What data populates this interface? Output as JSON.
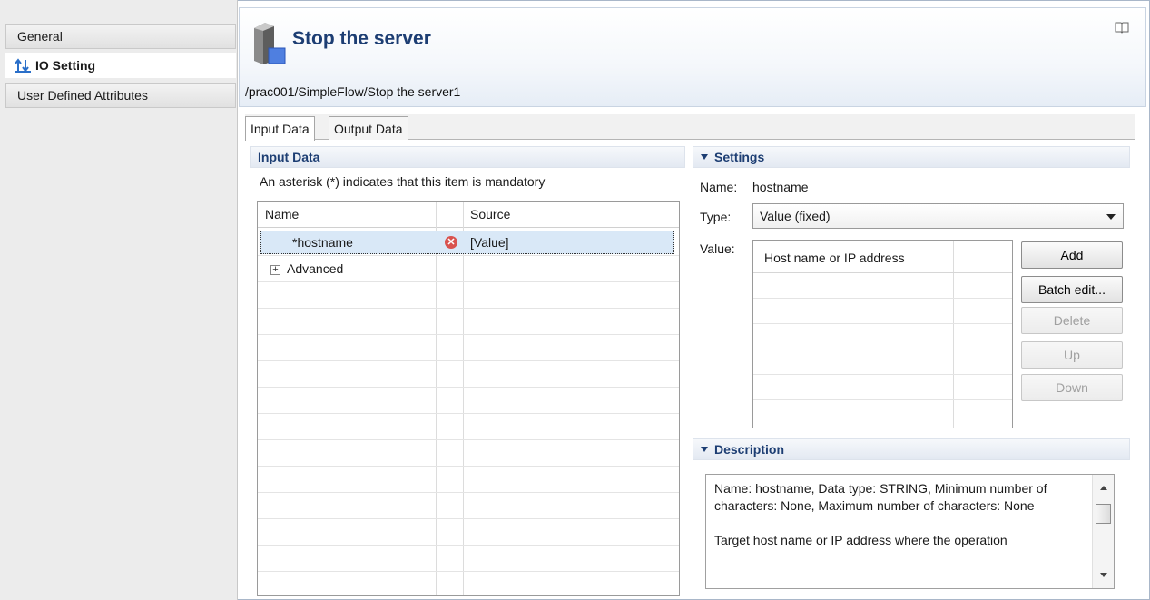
{
  "sidebar": {
    "items": [
      {
        "label": "General"
      },
      {
        "label": "IO Setting"
      },
      {
        "label": "User Defined Attributes"
      }
    ]
  },
  "header": {
    "title": "Stop the server",
    "path": "/prac001/SimpleFlow/Stop the server1"
  },
  "tabs": [
    {
      "label": "Input Data"
    },
    {
      "label": "Output Data"
    }
  ],
  "input_data": {
    "section_title": "Input Data",
    "hint": "An asterisk (*) indicates that this item is mandatory",
    "columns": [
      "Name",
      "Source"
    ],
    "rows": [
      {
        "name": "*hostname",
        "source": "[Value]"
      },
      {
        "name": "Advanced",
        "source": ""
      }
    ]
  },
  "settings": {
    "section_title": "Settings",
    "name_label": "Name:",
    "name_value": "hostname",
    "type_label": "Type:",
    "type_value": "Value (fixed)",
    "value_label": "Value:",
    "value_column": "Host name or IP address",
    "buttons": {
      "add": "Add",
      "batch_edit": "Batch edit...",
      "delete": "Delete",
      "up": "Up",
      "down": "Down"
    }
  },
  "description": {
    "section_title": "Description",
    "line1": "Name: hostname, Data type: STRING, Minimum number of characters: None, Maximum number of characters: None",
    "line2": "Target host name or IP address where the operation"
  },
  "colors": {
    "title": "#1d3e73",
    "error": "#d9534f",
    "selection": "#d9e8f7"
  }
}
